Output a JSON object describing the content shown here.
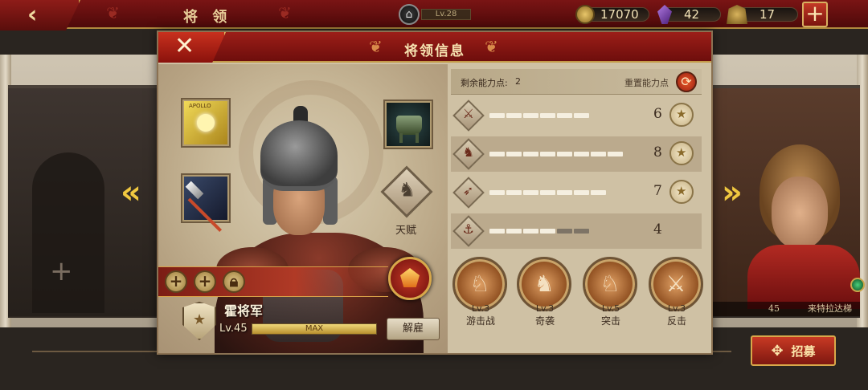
{
  "topbar": {
    "back_icon": "back-arrow-icon",
    "title": "将 领",
    "city_level": "Lv.28",
    "gold": "17070",
    "gems": "42",
    "helmets": "17",
    "add_icon": "plus-icon"
  },
  "dialog": {
    "title": "将领信息",
    "close_icon": "close-icon",
    "talent_label": "天赋",
    "general": {
      "name": "霍将军",
      "level": "Lv.45",
      "xp_label": "MAX",
      "xp_fraction": 1.0
    },
    "dismiss_label": "解雇",
    "equipment": [
      {
        "name": "apollo-banner",
        "tag": "APOLLO"
      },
      {
        "name": "spear"
      },
      {
        "name": "bronze-ding"
      }
    ],
    "actions": [
      "+",
      "+",
      "lock"
    ],
    "points": {
      "label": "剩余能力点:",
      "value": "2",
      "reset_label": "重置能力点"
    },
    "stats": [
      {
        "icon": "sword-icon",
        "value": "6",
        "filled": 6,
        "total": 6,
        "medal": true
      },
      {
        "icon": "horse-icon",
        "value": "8",
        "filled": 8,
        "total": 8,
        "medal": true
      },
      {
        "icon": "bow-icon",
        "value": "7",
        "filled": 7,
        "total": 7,
        "medal": true
      },
      {
        "icon": "anchor-icon",
        "value": "4",
        "filled": 4,
        "total": 6,
        "medal": false
      }
    ],
    "skills": [
      {
        "level": "Lv.3",
        "name": "游击战"
      },
      {
        "level": "Lv.3",
        "name": "奇袭"
      },
      {
        "level": "Lv.5",
        "name": "突击"
      },
      {
        "level": "Lv.3",
        "name": "反击"
      }
    ]
  },
  "background": {
    "right_card_name": "来特拉达梯",
    "right_card_level": "45"
  },
  "recruit_label": "招募",
  "colors": {
    "header_red": "#7a1414",
    "accent_gold": "#c9a24a",
    "panel_parchment": "#cfc1a4"
  }
}
